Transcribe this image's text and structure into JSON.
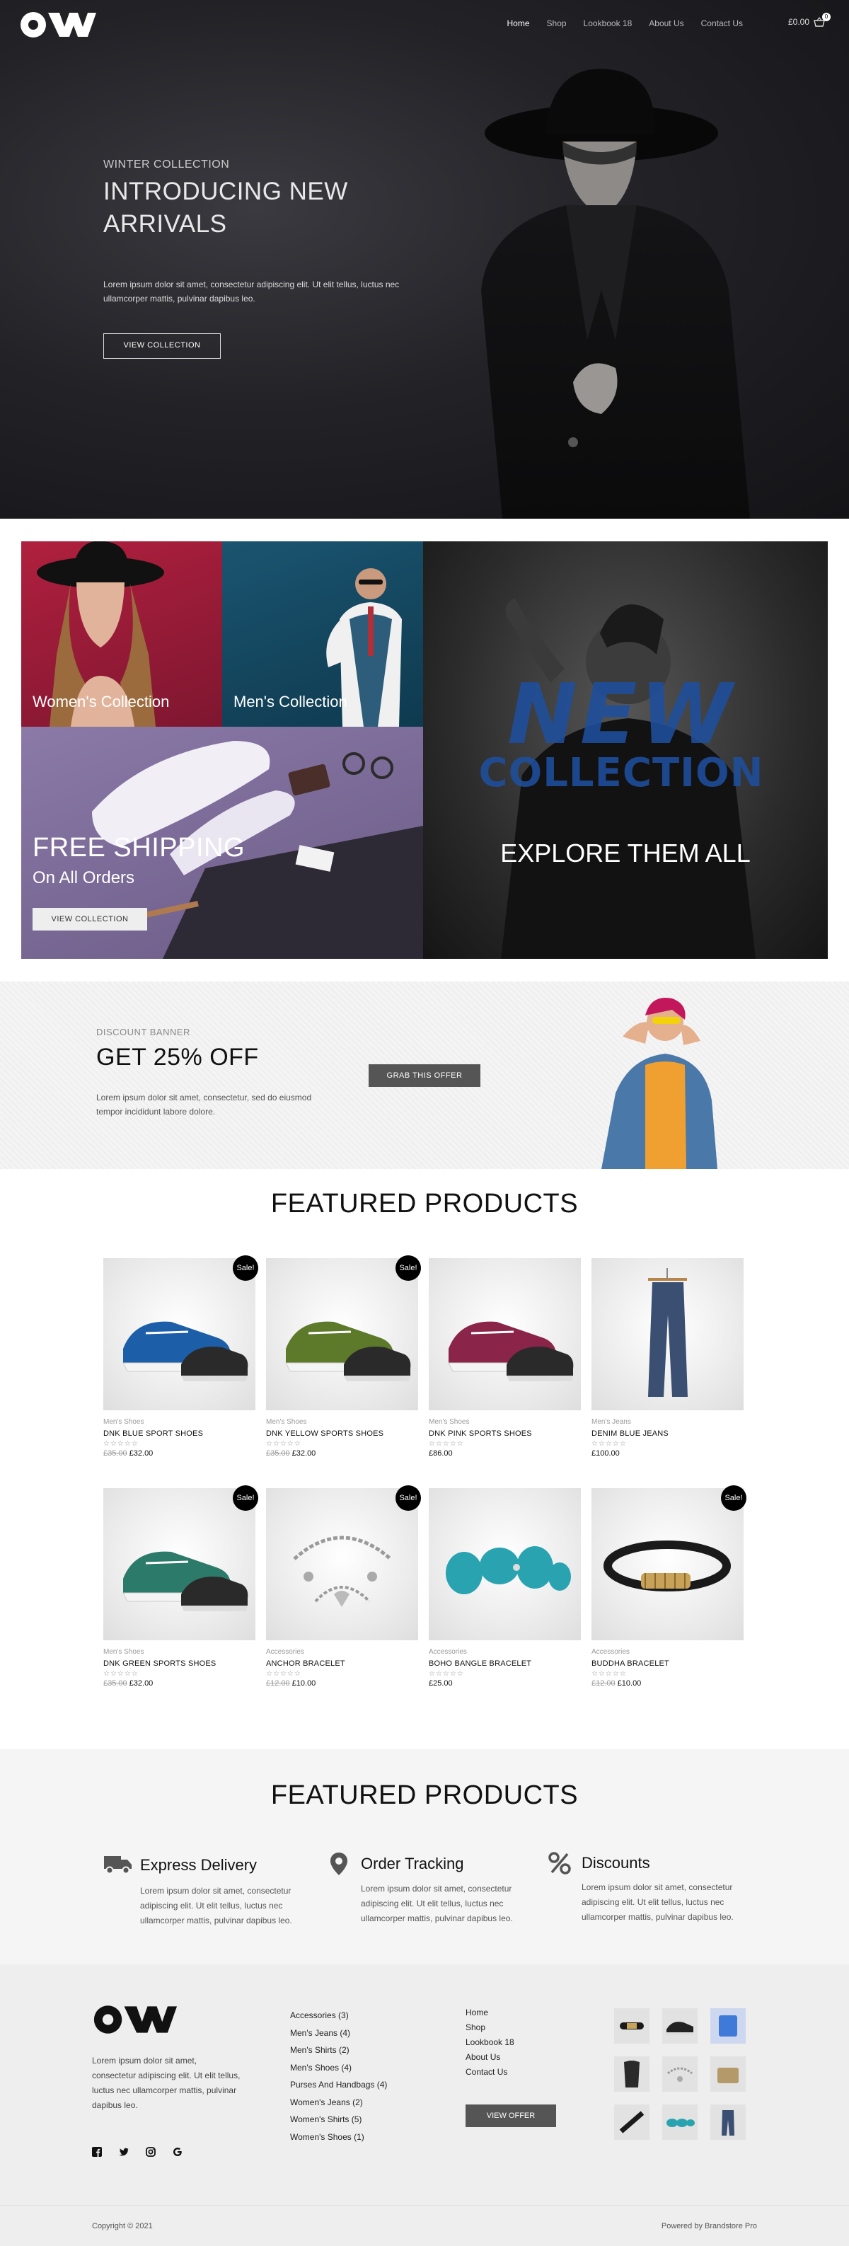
{
  "header": {
    "logo_alt": "OW",
    "nav": [
      "Home",
      "Shop",
      "Lookbook 18",
      "About Us",
      "Contact Us"
    ],
    "cart_total": "£0.00",
    "cart_count": "0"
  },
  "hero": {
    "eyebrow": "WINTER COLLECTION",
    "title": "INTRODUCING NEW ARRIVALS",
    "text": "Lorem ipsum dolor sit amet, consectetur adipiscing elit. Ut elit tellus, luctus nec ullamcorper mattis, pulvinar dapibus leo.",
    "button": "VIEW COLLECTION"
  },
  "collections": {
    "women": "Women's Collection",
    "men": "Men's Collection",
    "shipping_title": "FREE SHIPPING",
    "shipping_sub": "On All Orders",
    "shipping_button": "VIEW COLLECTION",
    "new_line1": "NEW",
    "new_line2": "COLLECTION",
    "explore": "EXPLORE THEM ALL"
  },
  "discount": {
    "eyebrow": "DISCOUNT BANNER",
    "title": "GET 25% OFF",
    "text": "Lorem ipsum dolor sit amet, consectetur, sed do eiusmod tempor incididunt labore dolore.",
    "button": "GRAB THIS OFFER"
  },
  "featured": {
    "title": "FEATURED PRODUCTS",
    "sale_label": "Sale!",
    "stars": "☆☆☆☆☆",
    "products": [
      {
        "category": "Men's Shoes",
        "name": "DNK BLUE SPORT SHOES",
        "old_price": "£35.00",
        "price": "£32.00",
        "sale": true,
        "kind": "shoe",
        "color": "#1c5fa8"
      },
      {
        "category": "Men's Shoes",
        "name": "DNK YELLOW SPORTS SHOES",
        "old_price": "£35.00",
        "price": "£32.00",
        "sale": true,
        "kind": "shoe",
        "color": "#5d7a2a"
      },
      {
        "category": "Men's Shoes",
        "name": "DNK PINK SPORTS SHOES",
        "old_price": "",
        "price": "£86.00",
        "sale": false,
        "kind": "shoe",
        "color": "#8a2448"
      },
      {
        "category": "Men's Jeans",
        "name": "DENIM BLUE JEANS",
        "old_price": "",
        "price": "£100.00",
        "sale": false,
        "kind": "jeans",
        "color": "#3b4f73"
      },
      {
        "category": "Men's Shoes",
        "name": "DNK GREEN SPORTS SHOES",
        "old_price": "£35.00",
        "price": "£32.00",
        "sale": true,
        "kind": "shoe",
        "color": "#2c7a6a"
      },
      {
        "category": "Accessories",
        "name": "ANCHOR BRACELET",
        "old_price": "£12.00",
        "price": "£10.00",
        "sale": true,
        "kind": "chain",
        "color": "#9a9a9a"
      },
      {
        "category": "Accessories",
        "name": "BOHO BANGLE BRACELET",
        "old_price": "",
        "price": "£25.00",
        "sale": false,
        "kind": "beads",
        "color": "#2aa3b0"
      },
      {
        "category": "Accessories",
        "name": "BUDDHA BRACELET",
        "old_price": "£12.00",
        "price": "£10.00",
        "sale": true,
        "kind": "leather",
        "color": "#1a1a1a"
      }
    ]
  },
  "features": {
    "title": "FEATURED PRODUCTS",
    "items": [
      {
        "icon": "truck-icon",
        "title": "Express Delivery",
        "text": "Lorem ipsum dolor sit amet, consectetur adipiscing elit. Ut elit tellus, luctus nec ullamcorper mattis, pulvinar dapibus leo."
      },
      {
        "icon": "location-pin-icon",
        "title": "Order Tracking",
        "text": "Lorem ipsum dolor sit amet, consectetur adipiscing elit. Ut elit tellus, luctus nec ullamcorper mattis, pulvinar dapibus leo."
      },
      {
        "icon": "percent-icon",
        "title": "Discounts",
        "text": "Lorem ipsum dolor sit amet, consectetur adipiscing elit. Ut elit tellus, luctus nec ullamcorper mattis, pulvinar dapibus leo."
      }
    ]
  },
  "footer": {
    "about": "Lorem ipsum dolor sit amet, consectetur adipiscing elit. Ut elit tellus, luctus nec ullamcorper mattis, pulvinar dapibus leo.",
    "social": [
      "facebook-icon",
      "twitter-icon",
      "instagram-icon",
      "google-icon"
    ],
    "categories": [
      "Accessories (3)",
      "Men's Jeans (4)",
      "Men's Shirts (2)",
      "Men's Shoes (4)",
      "Purses And Handbags (4)",
      "Women's Jeans (2)",
      "Women's Shirts (5)",
      "Women's Shoes (1)"
    ],
    "links": [
      "Home",
      "Shop",
      "Lookbook 18",
      "About Us",
      "Contact Us"
    ],
    "offer_button": "VIEW OFFER",
    "copyright": "Copyright © 2021",
    "powered": "Powered by Brandstore Pro"
  }
}
